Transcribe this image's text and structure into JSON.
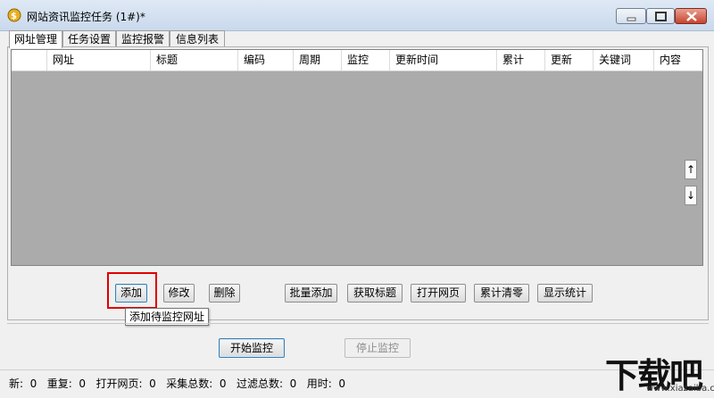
{
  "window": {
    "title": "网站资讯监控任务  (1#)*"
  },
  "tabs": [
    {
      "label": "网址管理",
      "active": true
    },
    {
      "label": "任务设置",
      "active": false
    },
    {
      "label": "监控报警",
      "active": false
    },
    {
      "label": "信息列表",
      "active": false
    }
  ],
  "table": {
    "columns": [
      "",
      "网址",
      "标题",
      "编码",
      "周期",
      "监控",
      "更新时间",
      "累计",
      "更新",
      "关键词",
      "内容"
    ],
    "rows": [],
    "scroll_up": "↑",
    "scroll_down": "↓"
  },
  "actions": {
    "add": "添加",
    "edit": "修改",
    "delete": "删除",
    "batch_add": "批量添加",
    "fetch_title": "获取标题",
    "open_page": "打开网页",
    "reset_total": "累计清零",
    "show_stats": "显示统计"
  },
  "tooltip": "添加待监控网址",
  "controls": {
    "start": "开始监控",
    "stop": "停止监控"
  },
  "status": "新:  0   重复:  0   打开网页:  0   采集总数:  0   过滤总数:  0   用时:  0",
  "watermark": {
    "text": "下载吧",
    "url": "www.xiazaiba.com"
  },
  "colors": {
    "grid_bg": "#ababab",
    "highlight": "#e00000",
    "focus": "#3c7fb1"
  }
}
